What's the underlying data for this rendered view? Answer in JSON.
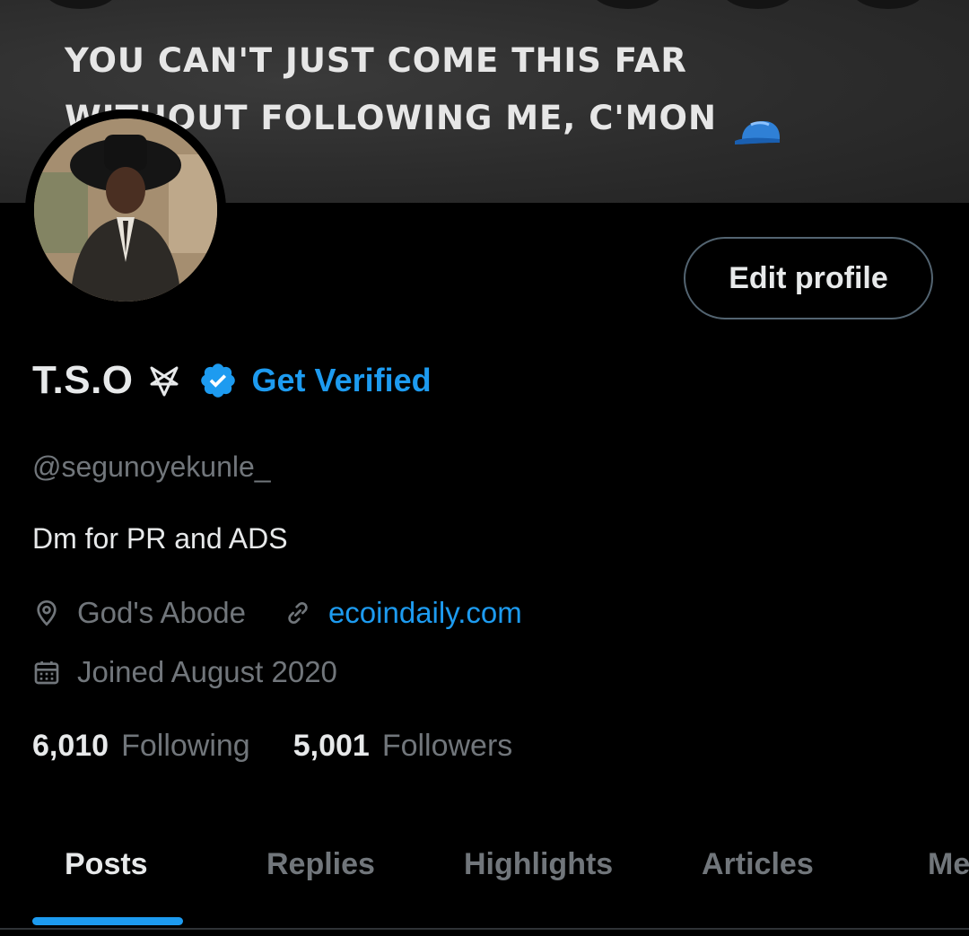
{
  "banner": {
    "line1": "YOU CAN'T JUST COME THIS FAR",
    "line2": "WITHOUT FOLLOWING ME, C'MON",
    "icon": "blue-cap-emoji"
  },
  "avatar": {
    "icon": "profile-photo"
  },
  "edit_profile_label": "Edit profile",
  "profile": {
    "display_name": "T.S.O",
    "name_icon": "pentagram-symbol",
    "verified_icon": "verified-badge",
    "get_verified_label": "Get Verified",
    "handle": "@segunoyekunle_",
    "bio": "Dm for PR and ADS",
    "location": "God's Abode",
    "location_icon": "location-pin-icon",
    "website": "ecoindaily.com",
    "website_icon": "link-icon",
    "joined": "Joined August 2020",
    "joined_icon": "calendar-icon"
  },
  "stats": {
    "following_count": "6,010",
    "following_label": "Following",
    "followers_count": "5,001",
    "followers_label": "Followers"
  },
  "tabs": [
    {
      "label": "Posts",
      "active": true
    },
    {
      "label": "Replies",
      "active": false
    },
    {
      "label": "Highlights",
      "active": false
    },
    {
      "label": "Articles",
      "active": false
    },
    {
      "label": "Media",
      "active": false
    }
  ],
  "colors": {
    "accent": "#1d9bf0",
    "background": "#000000",
    "text_primary": "#e7e9ea",
    "text_secondary": "#71767b",
    "border": "#536471"
  }
}
